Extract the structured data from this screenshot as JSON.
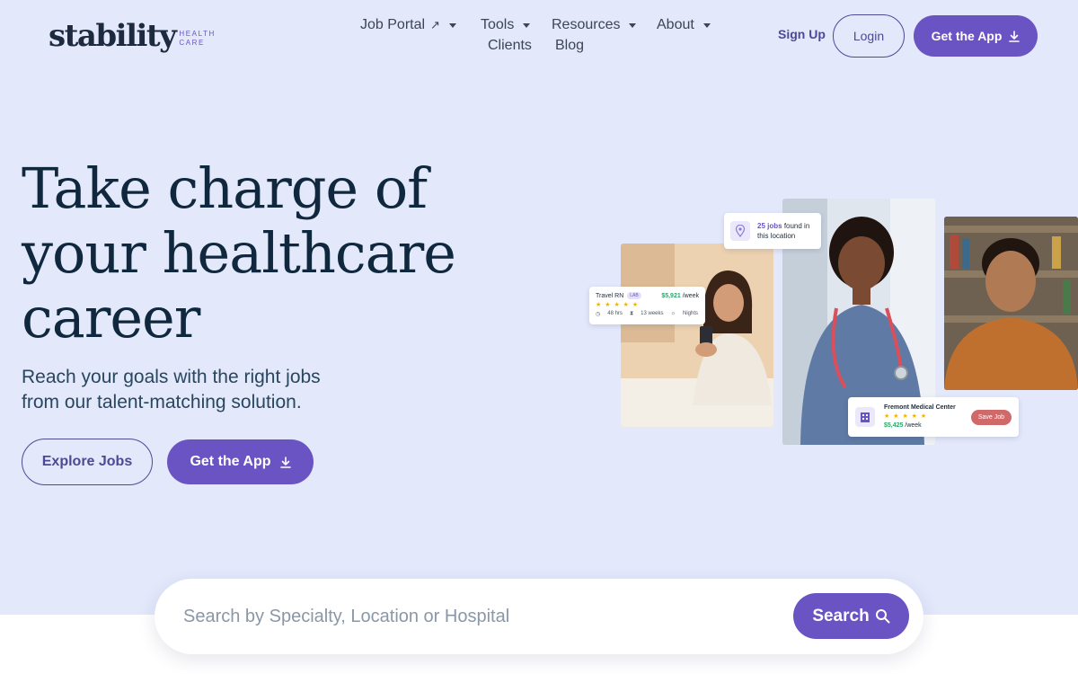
{
  "brand": {
    "name": "stability",
    "sub_line1": "HEALTH",
    "sub_line2": "CARE",
    "accent": "#6a54c4",
    "dark": "#10283d"
  },
  "nav": {
    "items": [
      {
        "label": "Job Portal",
        "icon": "arrow-up-right-icon",
        "has_dropdown": true
      },
      {
        "label": "Tools",
        "has_dropdown": true
      },
      {
        "label": "Resources",
        "has_dropdown": true
      },
      {
        "label": "About",
        "has_dropdown": true
      },
      {
        "label": "Clients",
        "has_dropdown": false
      },
      {
        "label": "Blog",
        "has_dropdown": false
      }
    ],
    "signup": "Sign Up",
    "login": "Login",
    "get_app": "Get the App"
  },
  "hero": {
    "headline_line1": "Take charge of",
    "headline_line2": "your healthcare",
    "headline_line3": "career",
    "sub_line1": "Reach your goals with the right jobs",
    "sub_line2": "from our talent-matching solution.",
    "explore": "Explore Jobs",
    "get_app": "Get the App"
  },
  "cards": {
    "travel": {
      "title": "Travel RN",
      "badge": "LAB",
      "pay": "$5,921",
      "unit": "/week",
      "stars": "★ ★ ★ ★ ★",
      "hours": "48 hrs",
      "weeks": "13 weeks",
      "shift": "Nights"
    },
    "jobs": {
      "count": "25 jobs",
      "found": "found in",
      "location": "this location"
    },
    "fremont": {
      "name": "Fremont Medical Center",
      "stars": "★ ★ ★ ★ ★",
      "pay": "$5,425",
      "unit": "/week",
      "save": "Save Job"
    }
  },
  "search": {
    "placeholder": "Search by Specialty, Location or Hospital",
    "button": "Search"
  }
}
